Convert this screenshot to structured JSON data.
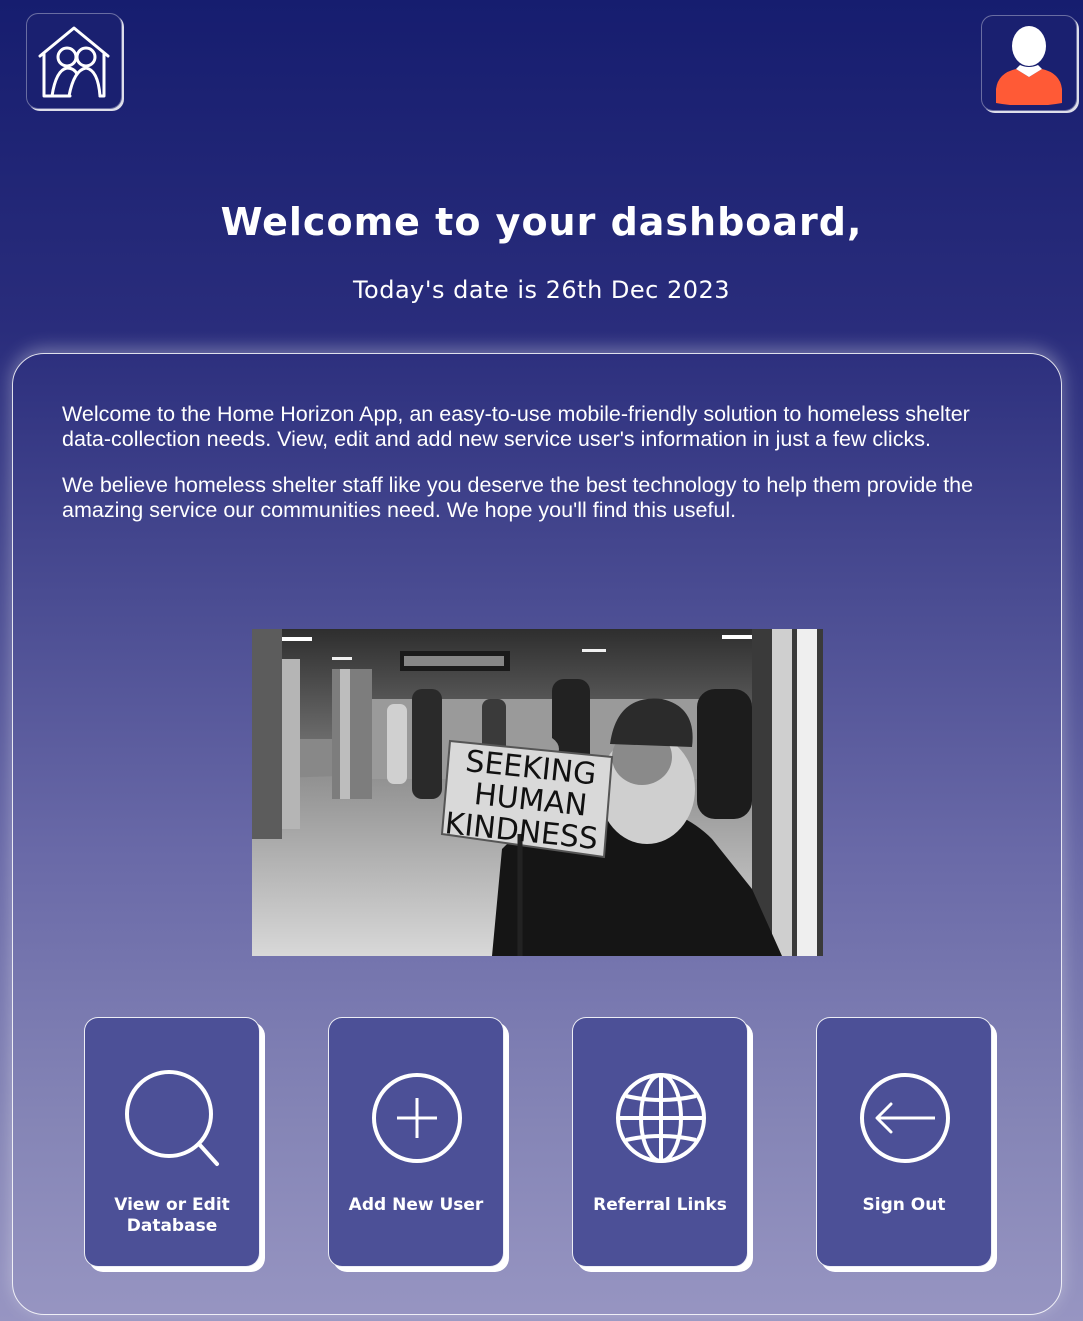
{
  "header": {
    "logo_icon": "home-group-icon",
    "profile_icon": "user-avatar-icon",
    "profile_accent": "#ff5a36"
  },
  "welcome": {
    "title": "Welcome to your dashboard,",
    "date_line": "Today's date is 26th Dec 2023"
  },
  "intro": {
    "paragraph_1": "Welcome to the Home Horizon App, an easy-to-use mobile-friendly solution to homeless shelter data-collection needs. View, edit and add new service user's information in just a few clicks.",
    "paragraph_2": "We believe homeless shelter staff like you deserve the best technology to help them provide the amazing service our communities need. We hope you'll find this useful."
  },
  "hero": {
    "sign_line_1": "SEEKING",
    "sign_line_2": "HUMAN",
    "sign_line_3": "KINDNESS"
  },
  "actions": [
    {
      "label": "View or Edit Database",
      "icon": "search-icon"
    },
    {
      "label": "Add New User",
      "icon": "plus-circle-icon"
    },
    {
      "label": "Referral Links",
      "icon": "globe-icon"
    },
    {
      "label": "Sign Out",
      "icon": "arrow-left-circle-icon"
    }
  ],
  "colors": {
    "background_top": "#161d6f",
    "background_bottom": "#9795c2",
    "tile": "#4c5097",
    "accent": "#ff5a36"
  }
}
